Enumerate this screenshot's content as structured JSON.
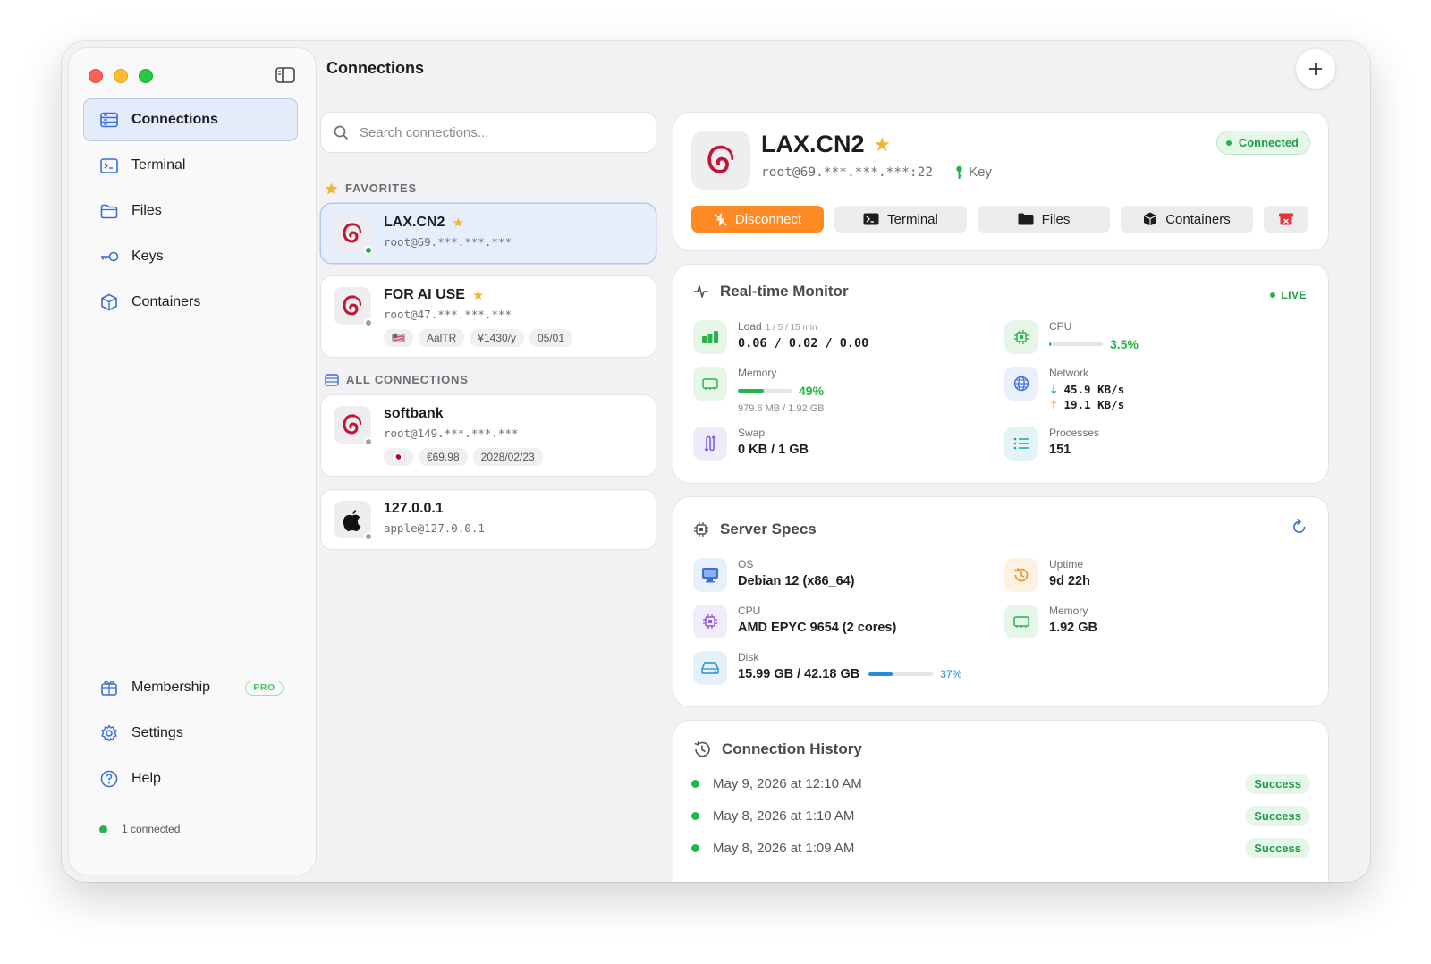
{
  "sidebar": {
    "nav": [
      {
        "label": "Connections",
        "icon": "server-icon",
        "active": true
      },
      {
        "label": "Terminal",
        "icon": "terminal-icon"
      },
      {
        "label": "Files",
        "icon": "folder-icon"
      },
      {
        "label": "Keys",
        "icon": "key-icon"
      },
      {
        "label": "Containers",
        "icon": "cube-icon"
      }
    ],
    "bottom": [
      {
        "label": "Membership",
        "icon": "gift-icon",
        "badge": "PRO"
      },
      {
        "label": "Settings",
        "icon": "gear-icon"
      },
      {
        "label": "Help",
        "icon": "question-icon"
      }
    ],
    "status": "1 connected"
  },
  "header": {
    "title": "Connections"
  },
  "search": {
    "placeholder": "Search connections..."
  },
  "favorites_label": "FAVORITES",
  "all_label": "ALL CONNECTIONS",
  "connections": [
    {
      "name": "LAX.CN2",
      "addr": "root@69.***.***.***",
      "star": "★",
      "online": true,
      "logo": "debian",
      "tags": []
    },
    {
      "name": "FOR AI USE",
      "addr": "root@47.***.***.***",
      "star": "★",
      "online": false,
      "logo": "debian",
      "tags": [
        "🇺🇸",
        "AalTR",
        "¥1430/y",
        "05/01"
      ]
    },
    {
      "name": "softbank",
      "addr": "root@149.***.***.***",
      "star": "",
      "online": false,
      "logo": "debian",
      "tags": [
        "🇯🇵",
        "€69.98",
        "2028/02/23"
      ]
    },
    {
      "name": "127.0.0.1",
      "addr": "apple@127.0.0.1",
      "star": "",
      "online": false,
      "logo": "apple",
      "tags": []
    }
  ],
  "detail": {
    "name": "LAX.CN2",
    "star": "★",
    "addr": "root@69.***.***.***:22",
    "auth": "Key",
    "status": "Connected",
    "actions": {
      "disconnect": "Disconnect",
      "terminal": "Terminal",
      "files": "Files",
      "containers": "Containers"
    }
  },
  "monitor": {
    "title": "Real-time Monitor",
    "live": "LIVE",
    "load": {
      "label": "Load",
      "sub": "1 / 5 / 15 min",
      "value": "0.06 / 0.02 / 0.00"
    },
    "cpu": {
      "label": "CPU",
      "pct": "3.5%",
      "fraction": 0.035
    },
    "memory": {
      "label": "Memory",
      "pct": "49%",
      "fraction": 0.49,
      "detail": "979.6 MB / 1.92 GB"
    },
    "network": {
      "label": "Network",
      "down": "45.9 KB/s",
      "up": "19.1 KB/s"
    },
    "swap": {
      "label": "Swap",
      "value": "0 KB / 1 GB"
    },
    "processes": {
      "label": "Processes",
      "value": "151"
    }
  },
  "specs": {
    "title": "Server Specs",
    "os": {
      "label": "OS",
      "value": "Debian 12 (x86_64)"
    },
    "uptime": {
      "label": "Uptime",
      "value": "9d 22h"
    },
    "cpu": {
      "label": "CPU",
      "value": "AMD EPYC 9654 (2 cores)"
    },
    "memory": {
      "label": "Memory",
      "value": "1.92 GB"
    },
    "disk": {
      "label": "Disk",
      "value": "15.99 GB / 42.18 GB",
      "pct": "37%",
      "fraction": 0.37
    }
  },
  "history": {
    "title": "Connection History",
    "items": [
      {
        "date": "May 9, 2026 at 12:10 AM",
        "status": "Success"
      },
      {
        "date": "May 8, 2026 at 1:10 AM",
        "status": "Success"
      },
      {
        "date": "May 8, 2026 at 1:09 AM",
        "status": "Success"
      }
    ]
  },
  "colors": {
    "accent": "#ff8a25",
    "success": "#28b34a",
    "star": "#f2b632",
    "brand_blue": "#3a6fd8"
  }
}
